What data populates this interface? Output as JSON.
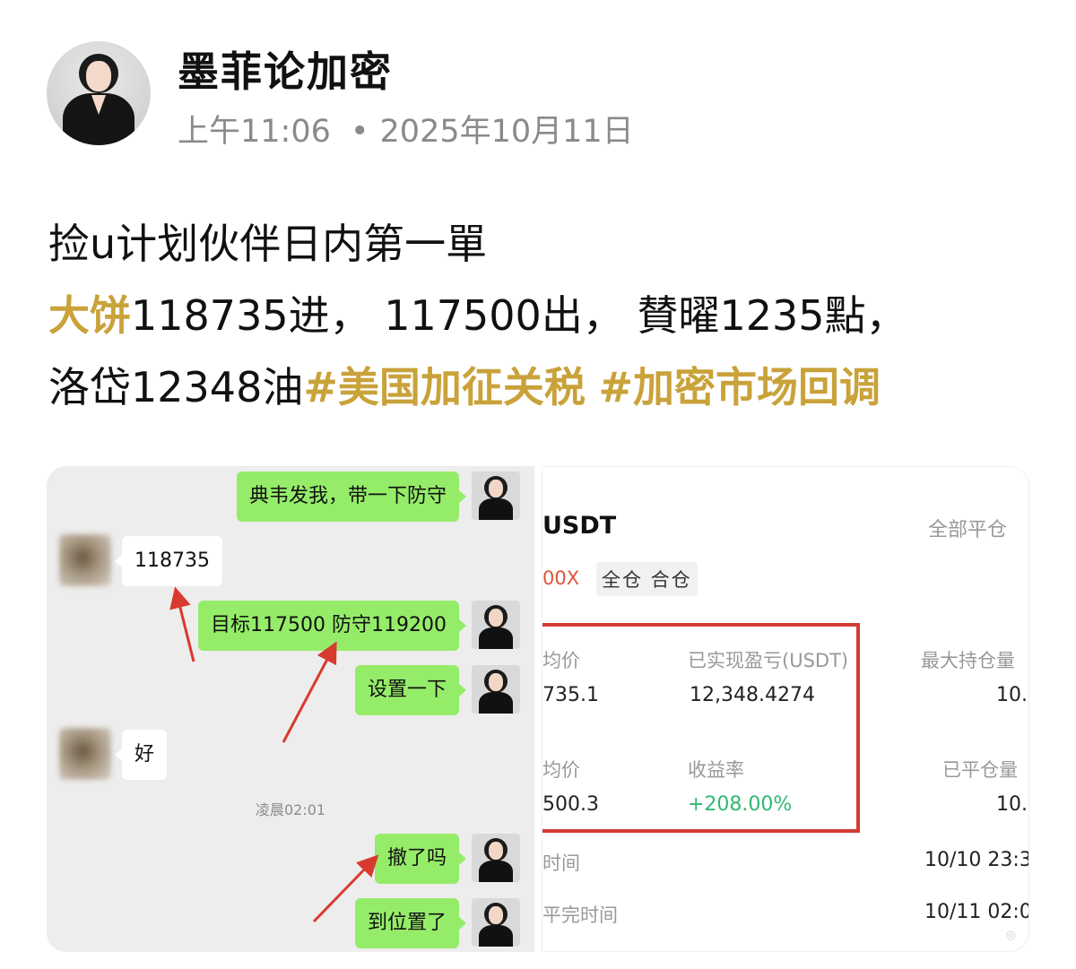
{
  "header": {
    "author": "墨菲论加密",
    "time": "上午11:06",
    "separator": "•",
    "date": "2025年10月11日"
  },
  "post": {
    "line1": "捡u计划伙伴日内第一單",
    "line2_highlight": "大饼",
    "line2_rest": "118735进， 117500出， 賛曜1235點，",
    "line3_text": "洛岱12348油",
    "hashtag1": "#美国加征关税",
    "hashtag2": "#加密市场回调"
  },
  "chat": {
    "messages": [
      {
        "side": "right",
        "text": "典韦发我，带一下防守"
      },
      {
        "side": "left",
        "text": "118735"
      },
      {
        "side": "right",
        "text": "目标117500 防守119200"
      },
      {
        "side": "right",
        "text": "设置一下"
      },
      {
        "side": "left",
        "text": "好"
      },
      {
        "side": "right",
        "text": "撤了吗"
      },
      {
        "side": "right",
        "text": "到位置了"
      }
    ],
    "timestamp": "凌晨02:01"
  },
  "trade": {
    "symbol": "USDT",
    "close_all": "全部平仓",
    "leverage": "00X",
    "margin_tags": "全仓 合仓",
    "open_price_label": "均价",
    "open_price_value": "735.1",
    "realized_pnl_label": "已实现盈亏(USDT)",
    "realized_pnl_value": "12,348.4274",
    "max_position_label": "最大持仓量",
    "max_position_value": "10.",
    "close_price_label": "均价",
    "close_price_value": "500.3",
    "roi_label": "收益率",
    "roi_value": "+208.00%",
    "closed_amount_label": "已平仓量",
    "closed_amount_value": "10.",
    "open_time_label": "时间",
    "open_time_value": "10/10 23:3",
    "close_time_label": "平完时间",
    "close_time_value": "10/11 02:0",
    "watermark": "◎",
    "accent_colors": {
      "highlight": "#c9a23a",
      "chat_green": "#95ec69",
      "box_red": "#d33b35",
      "roi_green": "#2fb872"
    }
  }
}
